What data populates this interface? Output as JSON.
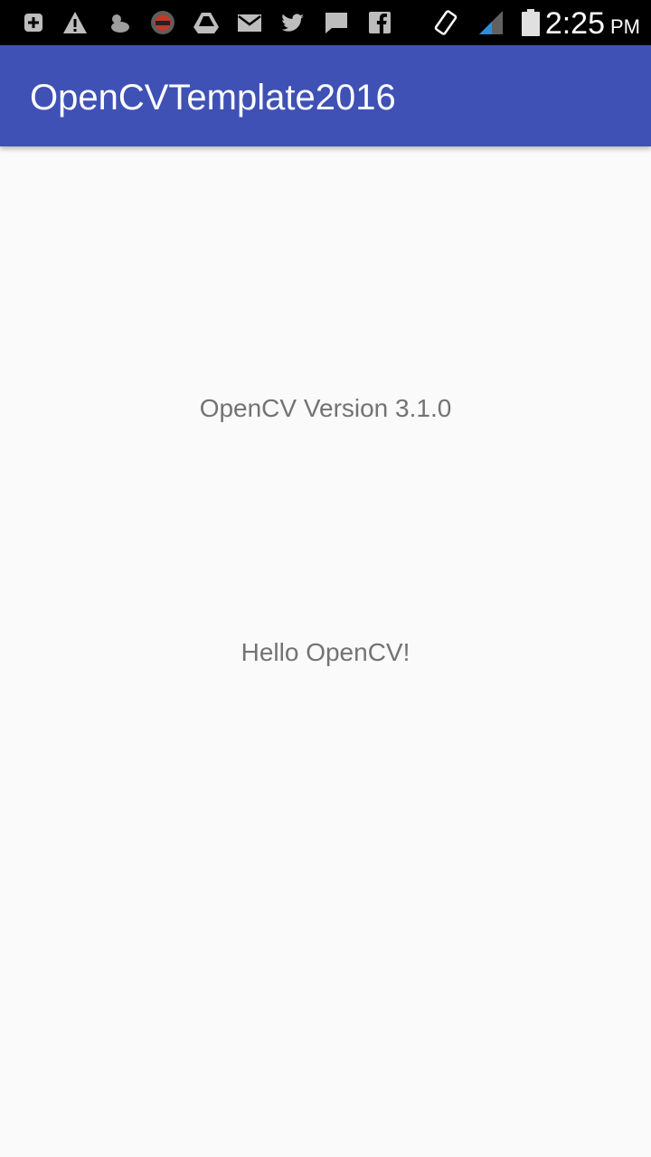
{
  "status_bar": {
    "time": "2:25",
    "ampm": "PM",
    "notification_icons": [
      "add-box-icon",
      "warning-icon",
      "weather-icon",
      "badge-app-icon",
      "drive-icon",
      "mail-icon",
      "twitter-icon",
      "message-icon",
      "facebook-icon"
    ],
    "system_icons": [
      "screen-rotation-icon",
      "signal-icon",
      "battery-icon"
    ]
  },
  "app_bar": {
    "title": "OpenCVTemplate2016",
    "color": "#3f51b5"
  },
  "main": {
    "version_text": "OpenCV Version 3.1.0",
    "hello_text": "Hello OpenCV!"
  }
}
